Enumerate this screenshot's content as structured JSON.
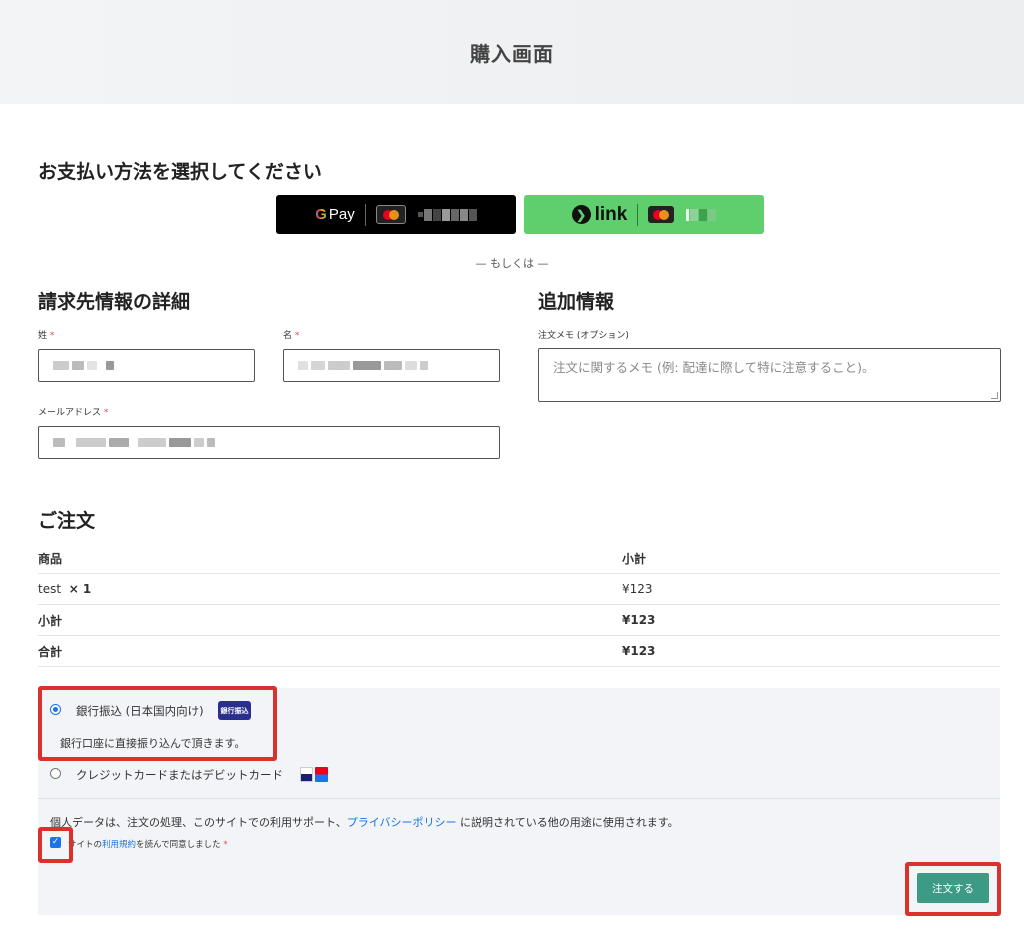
{
  "header": {
    "title": "購入画面"
  },
  "express": {
    "heading": "お支払い方法を選択してください",
    "gpay_label": "Pay",
    "gpay_g": "G",
    "link_label": "link",
    "or_text": "— もしくは —"
  },
  "billing": {
    "heading": "請求先情報の詳細",
    "last_name_label": "姓",
    "first_name_label": "名",
    "email_label": "メールアドレス",
    "required_mark": "*"
  },
  "additional": {
    "heading": "追加情報",
    "notes_label": "注文メモ (オプション)",
    "notes_placeholder": "注文に関するメモ (例: 配達に際して特に注意すること)。"
  },
  "order": {
    "heading": "ご注文",
    "col_product": "商品",
    "col_subtotal": "小計",
    "rows": [
      {
        "label": "test",
        "qty": "× 1",
        "value": "¥123"
      },
      {
        "label": "小計",
        "value": "¥123"
      },
      {
        "label": "合計",
        "value": "¥123"
      }
    ]
  },
  "payment": {
    "bank_label": "銀行振込 (日本国内向け)",
    "bank_badge": "銀行振込",
    "bank_desc": "銀行口座に直接振り込んで頂きます。",
    "card_label": "クレジットカードまたはデビットカード",
    "privacy_before": "個人データは、注文の処理、このサイトでの利用サポート、",
    "privacy_link": "プライバシーポリシー",
    "privacy_after": " に説明されている他の用途に使用されます。",
    "terms_before": "サイトの",
    "terms_link": "利用規約",
    "terms_after": "を読んで同意しました",
    "terms_checked": true,
    "place_order": "注文する"
  },
  "colors": {
    "accent": "#3d9a84",
    "link": "#1a73e8",
    "annotation": "#d9312b",
    "link_button": "#5fcf6e"
  }
}
